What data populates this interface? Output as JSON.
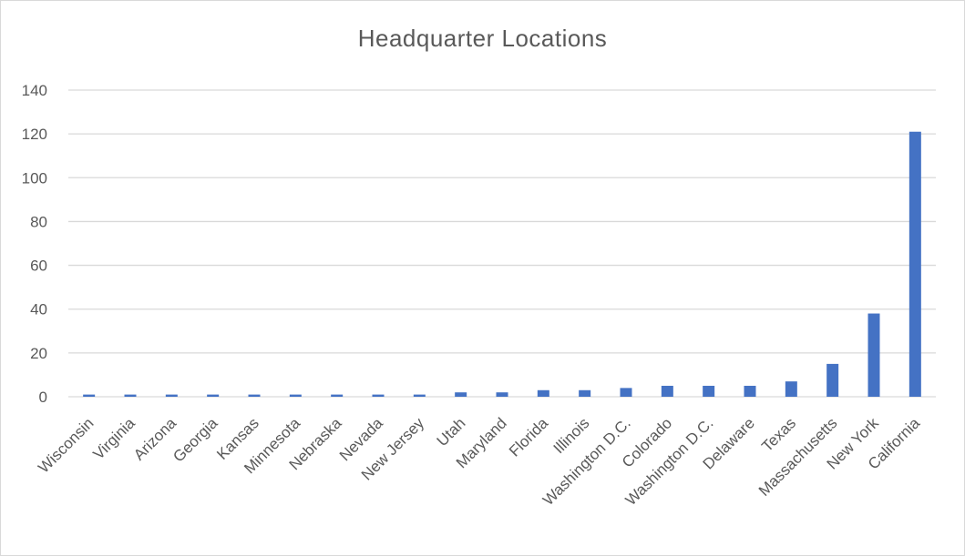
{
  "chart_data": {
    "type": "bar",
    "title": "Headquarter Locations",
    "xlabel": "",
    "ylabel": "",
    "categories": [
      "Wisconsin",
      "Virginia",
      "Arizona",
      "Georgia",
      "Kansas",
      "Minnesota",
      "Nebraska",
      "Nevada",
      "New Jersey",
      "Utah",
      "Maryland",
      "Florida",
      "Illinois",
      "Washington D.C.",
      "Colorado",
      "Washington D.C.",
      "Delaware",
      "Texas",
      "Massachusetts",
      "New York",
      "California"
    ],
    "values": [
      1,
      1,
      1,
      1,
      1,
      1,
      1,
      1,
      1,
      2,
      2,
      3,
      3,
      4,
      5,
      5,
      5,
      7,
      15,
      38,
      121
    ],
    "ylim": [
      0,
      140
    ],
    "yticks": [
      0,
      20,
      40,
      60,
      80,
      100,
      120,
      140
    ],
    "grid": true,
    "legend": "none",
    "bar_color": "#4472c4",
    "grid_color": "#d9d9d9"
  }
}
